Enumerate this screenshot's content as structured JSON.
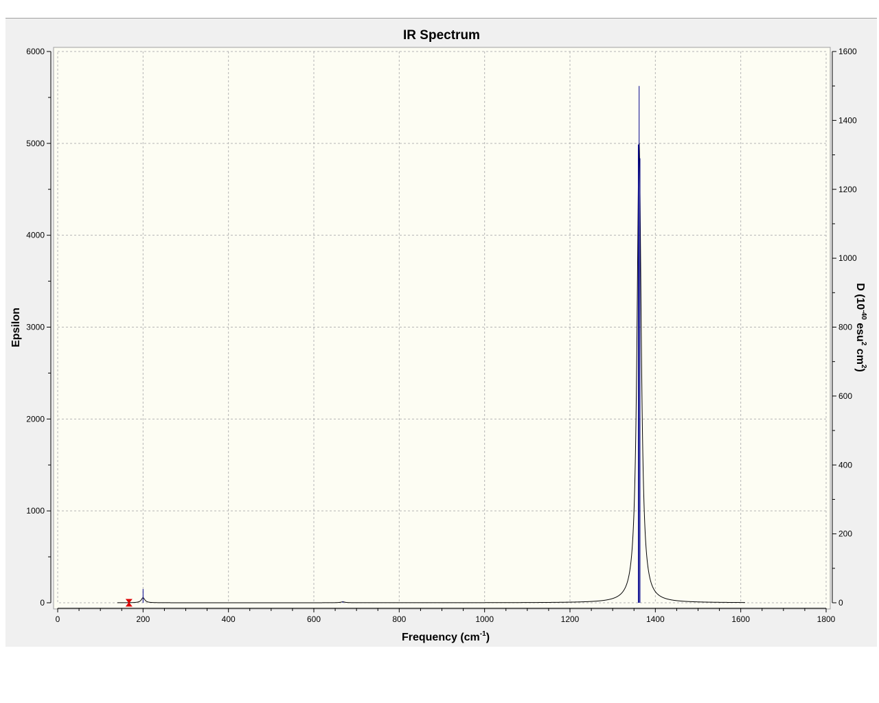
{
  "chart_data": {
    "type": "line",
    "title": "IR Spectrum",
    "xlabel": "Frequency (cm",
    "xlabel_sup": "-1",
    "xlabel_end": ")",
    "ylabel": "Epsilon",
    "y2label": {
      "p1": "D (10",
      "sup1": "-40",
      "p2": " esu",
      "sup2": "2",
      "p3": " cm",
      "sup3": "2",
      "p4": ")"
    },
    "xlim": [
      0,
      1800
    ],
    "ylim": [
      0,
      6000
    ],
    "y2lim": [
      0,
      1600
    ],
    "x_ticks": [
      0,
      200,
      400,
      600,
      800,
      1000,
      1200,
      1400,
      1600,
      1800
    ],
    "y_ticks": [
      0,
      1000,
      2000,
      3000,
      4000,
      5000,
      6000
    ],
    "y2_ticks": [
      0,
      200,
      400,
      600,
      800,
      1000,
      1200,
      1400,
      1600
    ],
    "grid": true,
    "colors": {
      "spectrum": "#000000",
      "sticks": "#00008b",
      "marker": "#dd0000",
      "plot_background": "#fdfdf3",
      "grid": "#b4b4b4"
    },
    "spectrum_range": [
      140,
      1610
    ],
    "peaks": [
      {
        "x": 200,
        "eps": 55,
        "hwhm": 5
      },
      {
        "x": 668,
        "eps": 10,
        "hwhm": 6
      },
      {
        "x": 1362,
        "eps": 5000,
        "hwhm": 6
      }
    ],
    "sticks": [
      {
        "x": 200,
        "d": 40
      },
      {
        "x": 668,
        "d": 4
      },
      {
        "x": 1360,
        "d": 1330
      },
      {
        "x": 1362,
        "d": 1500
      },
      {
        "x": 1364,
        "d": 1290
      }
    ],
    "marker": {
      "x": 167,
      "y": 0
    }
  }
}
